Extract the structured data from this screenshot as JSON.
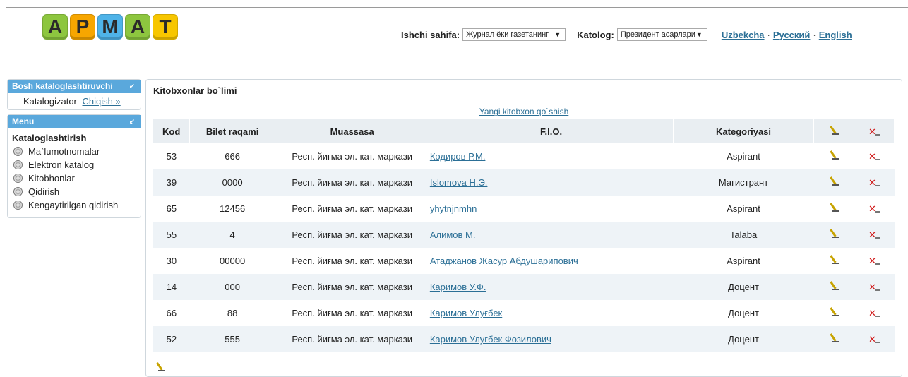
{
  "logo": {
    "letters": [
      "А",
      "Р",
      "М",
      "А",
      "Т"
    ]
  },
  "header": {
    "work_page_label": "Ishchi sahifa:",
    "work_page_value": "Журнал ёки газетанинг",
    "catalog_label": "Katolog:",
    "catalog_value": "Президент асарлари",
    "langs": [
      "Uzbekcha",
      "Русский",
      "English"
    ]
  },
  "sidebar": {
    "cataloger_panel": {
      "title": "Bosh kataloglashtiruvchi",
      "user": "Katalogizator",
      "logout": "Chiqish »"
    },
    "menu_panel": {
      "title": "Menu",
      "section": "Kataloglashtirish",
      "items": [
        "Ma`lumotnomalar",
        "Elektron katalog",
        "Kitobhonlar",
        "Qidirish",
        "Kengaytirilgan qidirish"
      ]
    }
  },
  "main": {
    "title": "Kitobxonlar bo`limi",
    "add_link": "Yangi kitobxon qo`shish",
    "columns": [
      "Kod",
      "Bilet raqami",
      "Muassasa",
      "F.I.O.",
      "Kategoriyasi"
    ],
    "rows": [
      {
        "kod": "53",
        "bilet": "666",
        "muassasa": "Респ. йиғма эл. кат. маркази",
        "fio": "Кодиров Р.М.",
        "kategoriya": "Aspirant"
      },
      {
        "kod": "39",
        "bilet": "0000",
        "muassasa": "Респ. йиғма эл. кат. маркази",
        "fio": "Islomova Н.Э.",
        "kategoriya": "Магистрант"
      },
      {
        "kod": "65",
        "bilet": "12456",
        "muassasa": "Респ. йиғма эл. кат. маркази",
        "fio": "yhytnjnmhn",
        "kategoriya": "Aspirant"
      },
      {
        "kod": "55",
        "bilet": "4",
        "muassasa": "Респ. йиғма эл. кат. маркази",
        "fio": "Алимов М.",
        "kategoriya": "Talaba"
      },
      {
        "kod": "30",
        "bilet": "00000",
        "muassasa": "Респ. йиғма эл. кат. маркази",
        "fio": "Атаджанов Жасур Абдушарипович",
        "kategoriya": "Aspirant"
      },
      {
        "kod": "14",
        "bilet": "000",
        "muassasa": "Респ. йиғма эл. кат. маркази",
        "fio": "Каримов У.Ф.",
        "kategoriya": "Доцент"
      },
      {
        "kod": "66",
        "bilet": "88",
        "muassasa": "Респ. йиғма эл. кат. маркази",
        "fio": "Каримов Улуғбек",
        "kategoriya": "Доцент"
      },
      {
        "kod": "52",
        "bilet": "555",
        "muassasa": "Респ. йиғма эл. кат. маркази",
        "fio": "Каримов Улуғбек Фозилович",
        "kategoriya": "Доцент"
      }
    ]
  }
}
